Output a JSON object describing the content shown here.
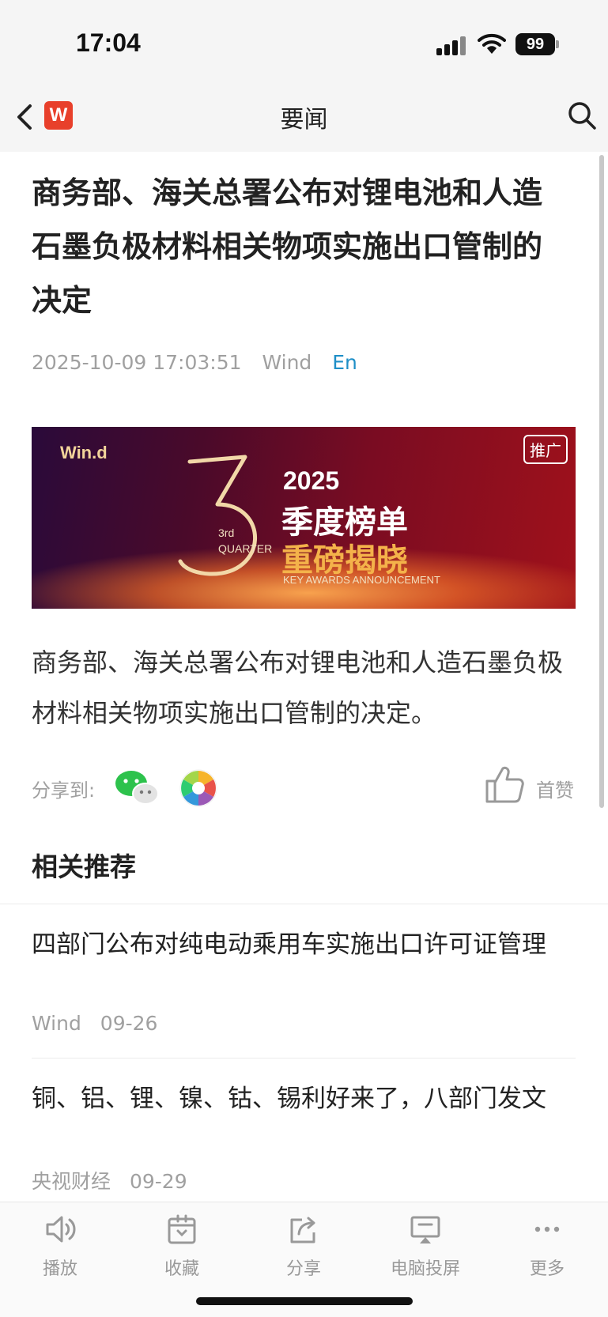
{
  "status_bar": {
    "time": "17:04",
    "battery": "99"
  },
  "nav": {
    "title": "要闻",
    "app_logo": "W"
  },
  "article": {
    "title": "商务部、海关总署公布对锂电池和人造石墨负极材料相关物项实施出口管制的决定",
    "datetime": "2025-10-09 17:03:51",
    "source": "Wind",
    "lang_toggle": "En",
    "body": "商务部、海关总署公布对锂电池和人造石墨负极材料相关物项实施出口管制的决定。"
  },
  "banner": {
    "brand": "Win.d",
    "tag": "推广",
    "quarter_line1": "3rd",
    "quarter_line2": "QUARTER",
    "year": "2025",
    "headline1": "季度榜单",
    "headline2": "重磅揭晓",
    "subtitle": "KEY AWARDS ANNOUNCEMENT"
  },
  "share": {
    "label": "分享到:",
    "like_label": "首赞"
  },
  "related": {
    "heading": "相关推荐",
    "items": [
      {
        "title": "四部门公布对纯电动乘用车实施出口许可证管理",
        "source": "Wind",
        "date": "09-26"
      },
      {
        "title": "铜、铝、锂、镍、钴、锡利好来了，八部门发文",
        "source": "央视财经",
        "date": "09-29"
      }
    ]
  },
  "toolbar": {
    "items": [
      {
        "label": "播放",
        "icon": "speaker-icon"
      },
      {
        "label": "收藏",
        "icon": "bookmark-icon"
      },
      {
        "label": "分享",
        "icon": "share-icon"
      },
      {
        "label": "电脑投屏",
        "icon": "cast-icon"
      },
      {
        "label": "更多",
        "icon": "more-icon"
      }
    ]
  },
  "colors": {
    "accent": "#1f8fc7",
    "logo": "#e8402b",
    "meta": "#a0a0a0"
  }
}
